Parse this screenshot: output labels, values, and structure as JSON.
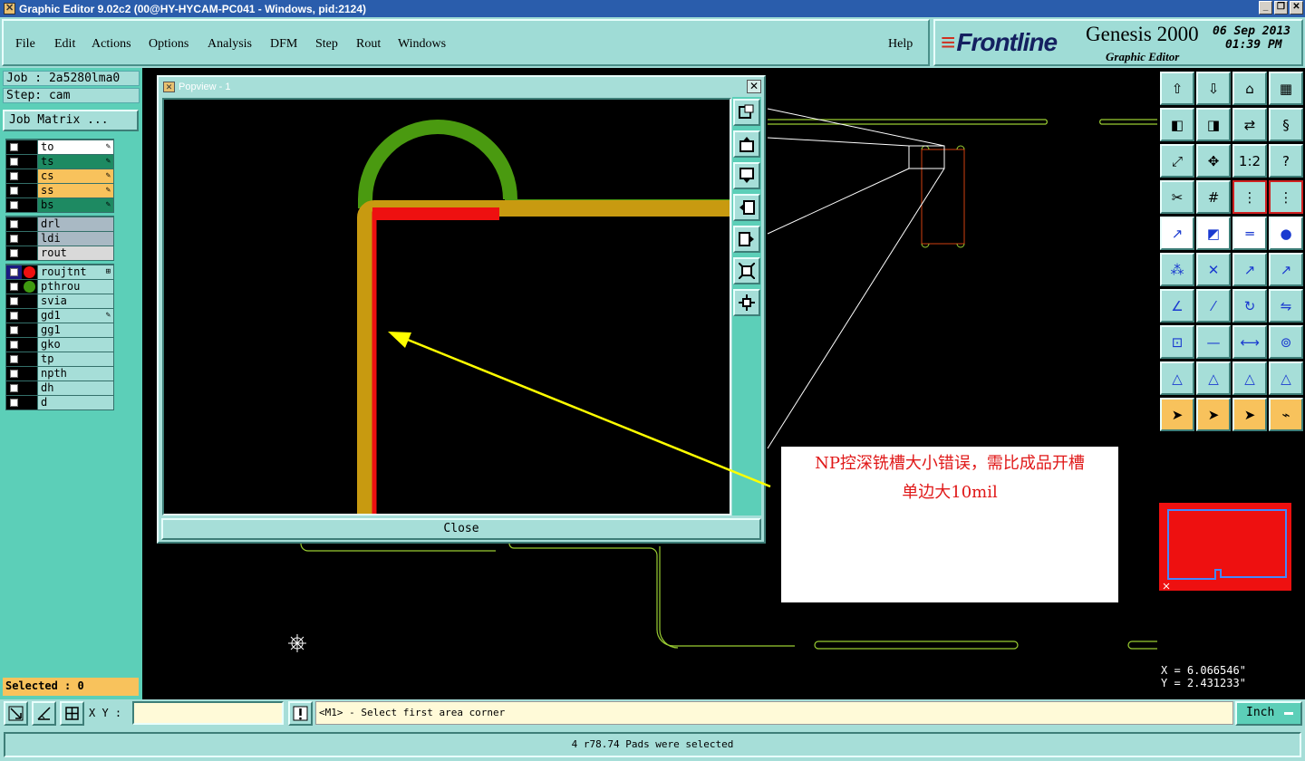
{
  "window": {
    "title": "Graphic Editor 9.02c2 (00@HY-HYCAM-PC041 - Windows, pid:2124)"
  },
  "menu": {
    "items": [
      {
        "label": "File"
      },
      {
        "label": "Edit"
      },
      {
        "label": "Actions"
      },
      {
        "label": "Options"
      },
      {
        "label": "Analysis"
      },
      {
        "label": "DFM"
      },
      {
        "label": "Step"
      },
      {
        "label": "Rout"
      },
      {
        "label": "Windows"
      }
    ],
    "help": "Help"
  },
  "logo": {
    "brand": "Frontline",
    "product": "Genesis 2000",
    "subtitle": "Graphic Editor",
    "date": "06 Sep 2013",
    "time": "01:39 PM"
  },
  "job": {
    "job_label": "Job : 2a5280lma0",
    "step_label": "Step: cam",
    "matrix_button": "Job Matrix ..."
  },
  "layers": {
    "group1": [
      {
        "name": "to",
        "color": "#ffffff",
        "mark": "✎"
      },
      {
        "name": "ts",
        "color": "#1e8a62",
        "mark": "✎"
      },
      {
        "name": "cs",
        "color": "#f8c25c",
        "mark": "✎"
      },
      {
        "name": "ss",
        "color": "#f8c25c",
        "mark": "✎"
      },
      {
        "name": "bs",
        "color": "#1e8a62",
        "mark": "✎"
      }
    ],
    "group2": [
      {
        "name": "drl",
        "color": "#a9b9c4"
      },
      {
        "name": "ldi",
        "color": "#a9b9c4"
      },
      {
        "name": "rout",
        "color": "#d9d9d9"
      }
    ],
    "group3": [
      {
        "name": "roujtnt",
        "color": "#a6ded8",
        "dot": "#ee1010",
        "mark": "⊞",
        "active": true
      },
      {
        "name": "pthrou",
        "color": "#a6ded8",
        "dot": "#3f9a10"
      },
      {
        "name": "svia",
        "color": "#a6ded8"
      },
      {
        "name": "gd1",
        "color": "#a6ded8",
        "mark": "✎"
      },
      {
        "name": "gg1",
        "color": "#a6ded8"
      },
      {
        "name": "gko",
        "color": "#a6ded8"
      },
      {
        "name": "tp",
        "color": "#a6ded8"
      },
      {
        "name": "npth",
        "color": "#a6ded8"
      },
      {
        "name": "dh",
        "color": "#a6ded8"
      },
      {
        "name": "d",
        "color": "#a6ded8"
      }
    ]
  },
  "selected": "Selected : 0",
  "popview": {
    "title": "Popview - 1",
    "close_label": "Close"
  },
  "annotation": {
    "line1": "NP控深铣槽大小错误，需比成品开槽",
    "line2": "单边大10mil"
  },
  "coords": {
    "x": "X = 6.066546\"",
    "y": "Y = 2.431233\""
  },
  "bottom": {
    "xy_label": "X Y :",
    "xy_value": "",
    "message": "<M1> - Select first area corner",
    "unit": "Inch"
  },
  "status": "4 r78.74 Pads were selected",
  "colors": {
    "panel": "#a6ded8",
    "panel_dark": "#5ccfb8",
    "highlight": "#f8c25c",
    "rout": "#ee1010",
    "pthrou": "#3f9a10",
    "outline": "#9acd32"
  }
}
